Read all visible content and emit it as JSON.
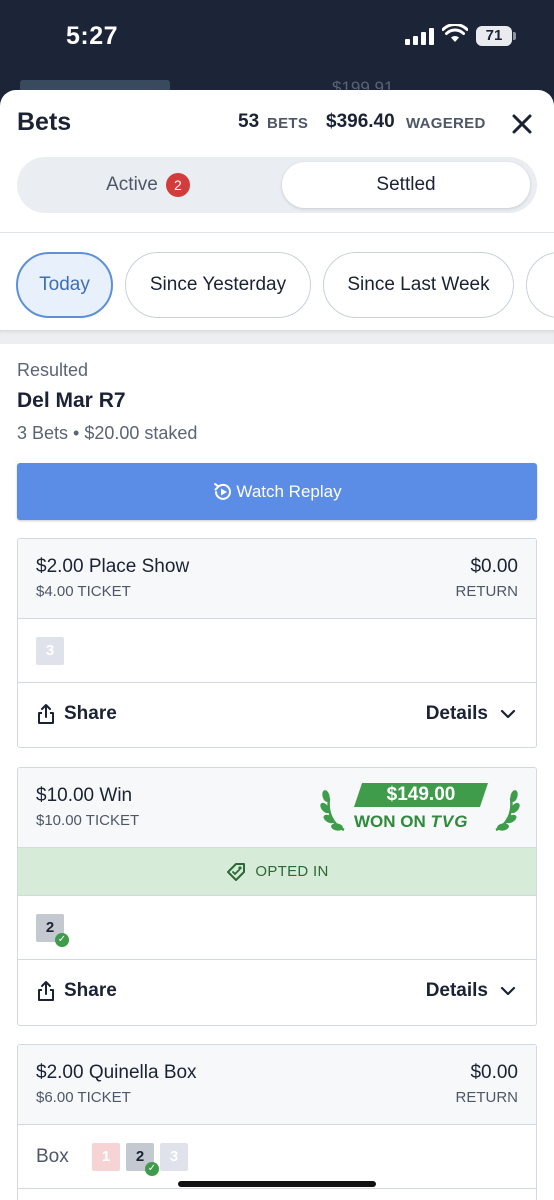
{
  "status": {
    "time": "5:27",
    "battery": "71",
    "obscured_amount": "$199.91"
  },
  "header": {
    "title": "Bets",
    "bet_count": "53",
    "bet_count_label": "BETS",
    "wagered_amount": "$396.40",
    "wagered_label": "WAGERED"
  },
  "tabs": {
    "active_label": "Active",
    "active_badge": "2",
    "settled_label": "Settled"
  },
  "filters": [
    {
      "label": "Today",
      "selected": true
    },
    {
      "label": "Since Yesterday",
      "selected": false
    },
    {
      "label": "Since Last Week",
      "selected": false
    }
  ],
  "race": {
    "status": "Resulted",
    "name": "Del Mar R7",
    "summary": "3 Bets • $20.00 staked",
    "replay_label": "Watch Replay"
  },
  "bets": [
    {
      "title": "$2.00 Place Show",
      "ticket": "$4.00 TICKET",
      "return_amount": "$0.00",
      "return_label": "RETURN",
      "selections": [
        "3"
      ],
      "share_label": "Share",
      "details_label": "Details"
    },
    {
      "title": "$10.00 Win",
      "ticket": "$10.00 TICKET",
      "won_amount": "$149.00",
      "won_label": "WON ON",
      "won_brand": "TVG",
      "opted_label": "OPTED IN",
      "selections": [
        "2"
      ],
      "share_label": "Share",
      "details_label": "Details"
    },
    {
      "title": "$2.00 Quinella Box",
      "ticket": "$6.00 TICKET",
      "return_amount": "$0.00",
      "return_label": "RETURN",
      "box_label": "Box",
      "selections": [
        "1",
        "2",
        "3"
      ]
    }
  ],
  "colors": {
    "accent": "#5b8de6",
    "win_green": "#3f9c4a",
    "badge_red": "#d43b3b",
    "opted_bg": "#d6ecd8"
  }
}
